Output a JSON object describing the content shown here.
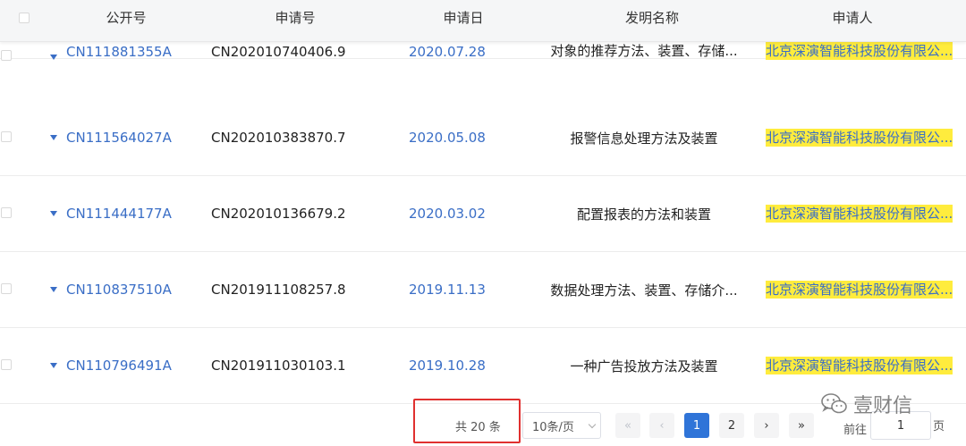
{
  "table": {
    "headers": {
      "pub_no": "公开号",
      "app_no": "申请号",
      "app_date": "申请日",
      "title": "发明名称",
      "applicant": "申请人"
    },
    "rows": [
      {
        "pub_no": "CN111881355A",
        "app_no": "CN202010740406.9",
        "app_date": "2020.07.28",
        "title": "对象的推荐方法、装置、存储...",
        "applicant": "北京深演智能科技股份有限公..."
      },
      {
        "pub_no": "CN111564027A",
        "app_no": "CN202010383870.7",
        "app_date": "2020.05.08",
        "title": "报警信息处理方法及装置",
        "applicant": "北京深演智能科技股份有限公..."
      },
      {
        "pub_no": "CN111444177A",
        "app_no": "CN202010136679.2",
        "app_date": "2020.03.02",
        "title": "配置报表的方法和装置",
        "applicant": "北京深演智能科技股份有限公..."
      },
      {
        "pub_no": "CN110837510A",
        "app_no": "CN201911108257.8",
        "app_date": "2019.11.13",
        "title": "数据处理方法、装置、存储介...",
        "applicant": "北京深演智能科技股份有限公..."
      },
      {
        "pub_no": "CN110796491A",
        "app_no": "CN201911030103.1",
        "app_date": "2019.10.28",
        "title": "一种广告投放方法及装置",
        "applicant": "北京深演智能科技股份有限公..."
      }
    ]
  },
  "pagination": {
    "total": "共 20 条",
    "page_size": "10条/页",
    "first": "«",
    "prev": "‹",
    "pages": [
      "1",
      "2"
    ],
    "current_page": "1",
    "next": "›",
    "last": "»",
    "goto_label": "前往",
    "goto_value": "1",
    "goto_suffix": "页"
  },
  "watermark": {
    "text": "壹财信",
    "icon": "wechat-icon"
  },
  "colors": {
    "link": "#3a6ec6",
    "highlight": "#ffec3d",
    "active_page": "#2f74d8",
    "annotation_box": "#e0302f"
  }
}
